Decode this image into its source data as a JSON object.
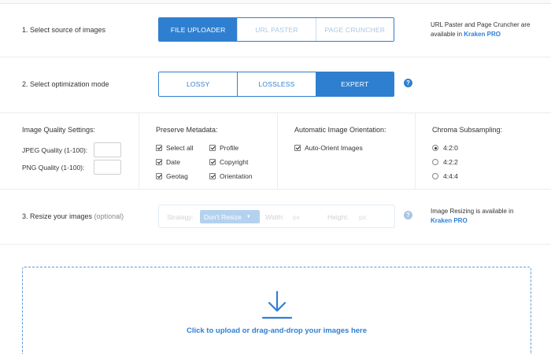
{
  "source": {
    "label": "1. Select source of images",
    "buttons": [
      "FILE UPLOADER",
      "URL PASTER",
      "PAGE CRUNCHER"
    ],
    "active": "FILE UPLOADER",
    "note_text": "URL Paster and Page Cruncher are available in",
    "note_link": "Kraken PRO"
  },
  "mode": {
    "label": "2. Select optimization mode",
    "buttons": [
      "LOSSY",
      "LOSSLESS",
      "EXPERT"
    ],
    "active": "EXPERT",
    "help": "?"
  },
  "quality": {
    "title": "Image Quality Settings:",
    "jpeg_label": "JPEG Quality (1-100):",
    "png_label": "PNG Quality (1-100):"
  },
  "metadata": {
    "title": "Preserve Metadata:",
    "items": [
      {
        "label": "Select all",
        "checked": true
      },
      {
        "label": "Profile",
        "checked": true
      },
      {
        "label": "Date",
        "checked": true
      },
      {
        "label": "Copyright",
        "checked": true
      },
      {
        "label": "Geotag",
        "checked": true
      },
      {
        "label": "Orientation",
        "checked": true
      }
    ]
  },
  "orientation": {
    "title": "Automatic Image Orientation:",
    "auto_label": "Auto-Orient Images",
    "checked": true
  },
  "chroma": {
    "title": "Chroma Subsampling:",
    "options": [
      "4:2:0",
      "4:2:2",
      "4:4:4"
    ],
    "selected": "4:2:0"
  },
  "resize": {
    "label": "3. Resize your images",
    "optional": "(optional)",
    "strategy_label": "Strategy:",
    "strategy_value": "Don't Resize",
    "width_label": "Width:",
    "width_unit": "px",
    "height_label": "Height:",
    "height_unit": "px",
    "help": "?",
    "note_text": "Image Resizing is available in",
    "note_link": "Kraken PRO"
  },
  "upload": {
    "text": "Click to upload or drag-and-drop your images here"
  },
  "colors": {
    "accent": "#2f7fd1",
    "muted_accent": "#9cc3ea"
  }
}
